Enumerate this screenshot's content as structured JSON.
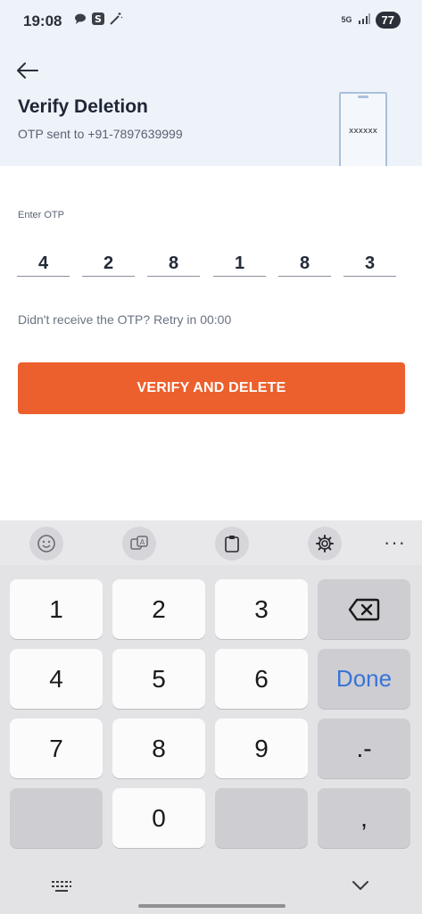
{
  "status_bar": {
    "time": "19:08",
    "network": "5G",
    "battery": "77"
  },
  "header": {
    "title": "Verify Deletion",
    "subtitle": "OTP sent to +91-7897639999",
    "illustration_text": "xxxxxx"
  },
  "form": {
    "otp_label": "Enter OTP",
    "otp_digits": [
      "4",
      "2",
      "8",
      "1",
      "8",
      "3"
    ],
    "retry_text": "Didn't receive the OTP? Retry in 00:00",
    "verify_button": "VERIFY AND DELETE"
  },
  "keyboard": {
    "keys": {
      "k1": "1",
      "k2": "2",
      "k3": "3",
      "k4": "4",
      "k5": "5",
      "k6": "6",
      "k7": "7",
      "k8": "8",
      "k9": "9",
      "k0": "0",
      "done": "Done",
      "dot_dash": ".-",
      "comma": ","
    },
    "toolbar_more": "···"
  },
  "colors": {
    "accent": "#ec602d",
    "header_bg": "#eef3f9",
    "done_text": "#3a74d6"
  }
}
